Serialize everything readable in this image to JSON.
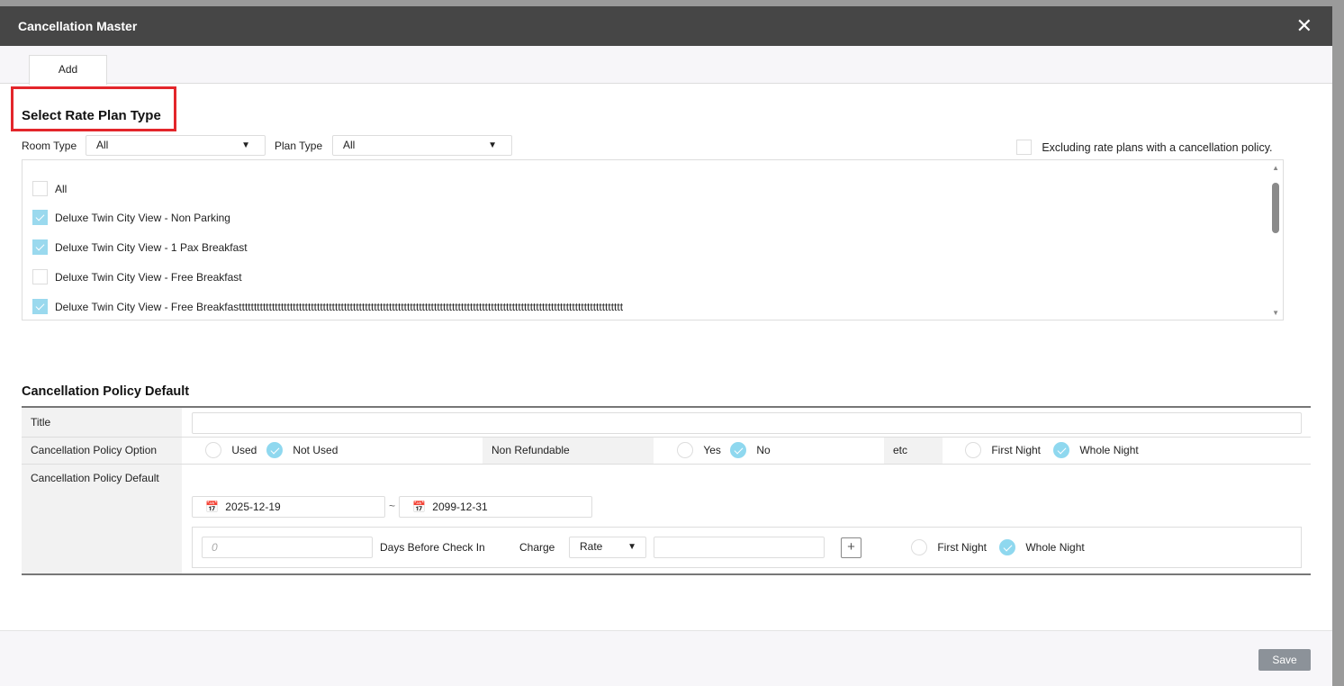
{
  "modal": {
    "title": "Cancellation Master",
    "close_icon": "close-icon"
  },
  "tabs": [
    {
      "label": "Add",
      "active": true
    }
  ],
  "rate_plan": {
    "heading": "Select Rate Plan Type",
    "room_type_label": "Room Type",
    "room_type_value": "All",
    "plan_type_label": "Plan Type",
    "plan_type_value": "All",
    "exclude_label": "Excluding rate plans with a cancellation policy.",
    "exclude_checked": false,
    "items": [
      {
        "label": "All",
        "checked": false
      },
      {
        "label": "Deluxe Twin City View - Non Parking",
        "checked": true
      },
      {
        "label": "Deluxe Twin City View - 1 Pax Breakfast",
        "checked": true
      },
      {
        "label": "Deluxe Twin City View - Free Breakfast",
        "checked": false
      },
      {
        "label": "Deluxe Twin City View - Free Breakfastttttttttttttttttttttttttttttttttttttttttttttttttttttttttttttttttttttttttttttttttttttttttttttttttttttttttttttttttttttttttttttttt",
        "checked": true
      }
    ]
  },
  "policy": {
    "heading": "Cancellation Policy Default",
    "title_label": "Title",
    "title_value": "",
    "option_label": "Cancellation Policy Option",
    "used": "Used",
    "not_used": "Not Used",
    "non_refundable_label": "Non Refundable",
    "yes": "Yes",
    "no": "No",
    "etc_label": "etc",
    "first_night": "First Night",
    "whole_night": "Whole Night",
    "default_label": "Cancellation Policy Default",
    "date_from": "2025-12-19",
    "date_sep": "~",
    "date_to": "2099-12-31",
    "days_placeholder": "0",
    "days_label": "Days Before Check In",
    "charge_label": "Charge",
    "charge_value": "Rate",
    "charge_amount": "",
    "add_symbol": "+",
    "first_night2": "First Night",
    "whole_night2": "Whole Night"
  },
  "footer": {
    "save_label": "Save"
  }
}
